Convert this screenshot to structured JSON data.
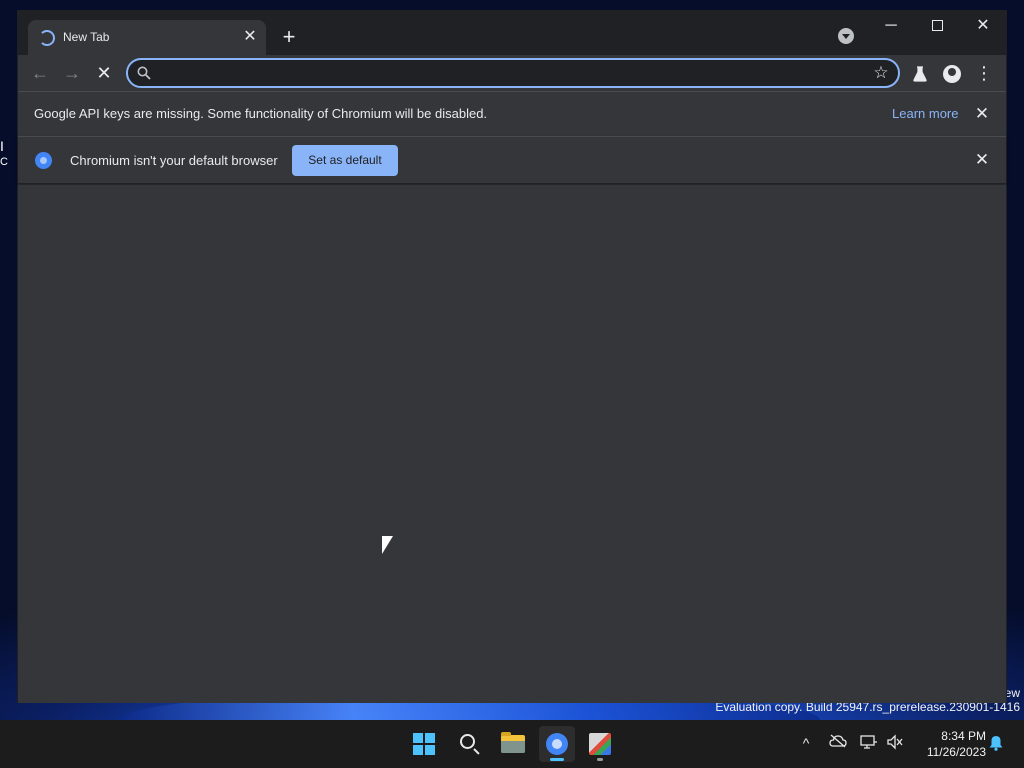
{
  "browser": {
    "tab": {
      "title": "New Tab"
    },
    "omnibox": {
      "value": "",
      "placeholder": ""
    },
    "infobars": {
      "api_keys": {
        "message": "Google API keys are missing. Some functionality of Chromium will be disabled.",
        "link": "Learn more"
      },
      "default_browser": {
        "message": "Chromium isn't your default browser",
        "button": "Set as default"
      }
    }
  },
  "desktop": {
    "fragment_1": "I",
    "fragment_2": "C",
    "watermark_edition": "ew",
    "watermark_build": "Evaluation copy. Build 25947.rs_prerelease.230901-1416"
  },
  "taskbar": {
    "time": "8:34 PM",
    "date": "11/26/2023"
  },
  "colors": {
    "window_bg": "#35363a",
    "titlebar_bg": "#202124",
    "accent_blue": "#8ab4f8",
    "taskbar_bg": "#1c1c1c"
  }
}
